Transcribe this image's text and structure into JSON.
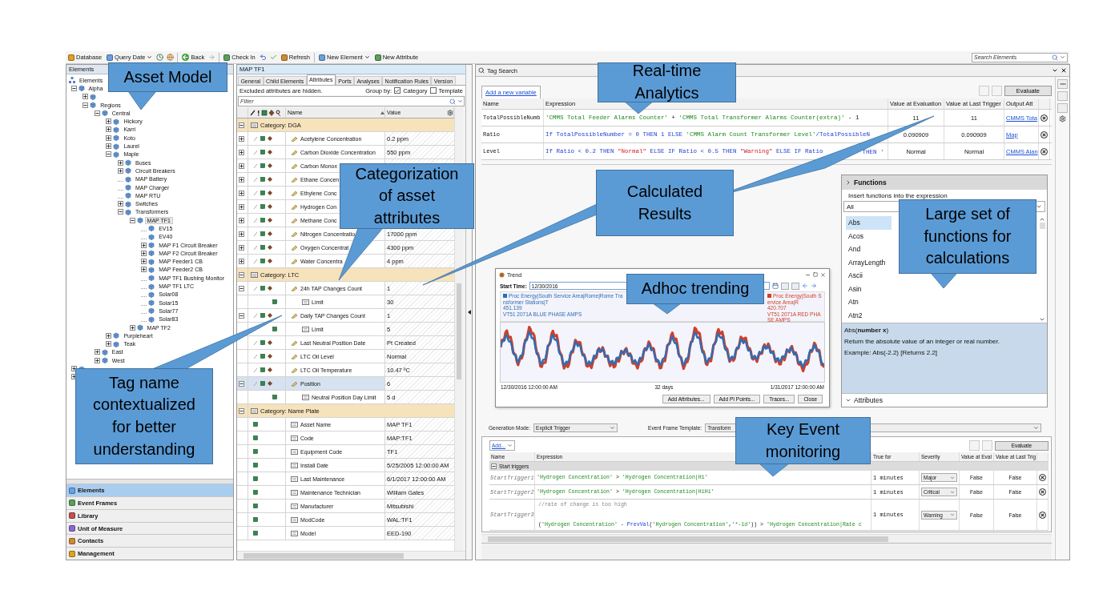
{
  "toolbar": {
    "items": [
      {
        "kind": "button",
        "label": "Database"
      },
      {
        "kind": "menu",
        "label": "Query Date"
      },
      {
        "kind": "clock"
      },
      {
        "kind": "globe"
      },
      {
        "kind": "separator"
      },
      {
        "kind": "back",
        "label": "Back"
      },
      {
        "kind": "forward"
      },
      {
        "kind": "separator"
      },
      {
        "kind": "button",
        "label": "Check In"
      },
      {
        "kind": "undo"
      },
      {
        "kind": "check"
      },
      {
        "kind": "button",
        "label": "Refresh"
      },
      {
        "kind": "separator"
      },
      {
        "kind": "menu",
        "label": "New Element"
      },
      {
        "kind": "button",
        "label": "New Attribute"
      }
    ],
    "search": {
      "placeholder": "Search Elements"
    }
  },
  "elements_panel": {
    "title": "Elements",
    "tree": [
      {
        "label": "Elements",
        "selected": false,
        "children": [
          {
            "label": "Alpha",
            "selected": false,
            "expanded": true,
            "children": [
              {
                "expanded": false
              },
              {
                "label": "Regions",
                "selected": false,
                "expanded": true,
                "children": [
                  {
                    "label": "Central",
                    "selected": false,
                    "expanded": true,
                    "children": [
                      {
                        "label": "Hickory",
                        "selected": false,
                        "expanded": false
                      },
                      {
                        "label": "Karri",
                        "selected": false,
                        "expanded": false
                      },
                      {
                        "label": "Koto",
                        "selected": false,
                        "expanded": false
                      },
                      {
                        "label": "Laurel",
                        "selected": false,
                        "expanded": false
                      },
                      {
                        "label": "Maple",
                        "selected": false,
                        "expanded": true,
                        "children": [
                          {
                            "label": "Buses",
                            "selected": false,
                            "expanded": false
                          },
                          {
                            "label": "Circuit Breakers",
                            "selected": false,
                            "expanded": false
                          },
                          {
                            "label": "MAP Battery",
                            "selected": false
                          },
                          {
                            "label": "MAP Charger",
                            "selected": false
                          },
                          {
                            "label": "MAP RTU",
                            "selected": false
                          },
                          {
                            "label": "Switches",
                            "selected": false,
                            "expanded": false
                          },
                          {
                            "label": "Transformers",
                            "selected": false,
                            "expanded": true,
                            "children": [
                              {
                                "label": "MAP TF1",
                                "selected": true,
                                "expanded": true,
                                "children": [
                                  {
                                    "label": "EV15",
                                    "selected": false
                                  },
                                  {
                                    "label": "EV40",
                                    "selected": false
                                  },
                                  {
                                    "label": "MAP F1 Circuit Breaker",
                                    "selected": false,
                                    "expanded": false
                                  },
                                  {
                                    "label": "MAP F2 Circuit Breaker",
                                    "selected": false,
                                    "expanded": false
                                  },
                                  {
                                    "label": "MAP Feeder1 CB",
                                    "selected": false,
                                    "expanded": false
                                  },
                                  {
                                    "label": "MAP Feeder2 CB",
                                    "selected": false,
                                    "expanded": false
                                  },
                                  {
                                    "label": "MAP TF1 Bushing Monitor",
                                    "selected": false
                                  },
                                  {
                                    "label": "MAP TF1 LTC",
                                    "selected": false
                                  },
                                  {
                                    "label": "Solar08",
                                    "selected": false
                                  },
                                  {
                                    "label": "Solar15",
                                    "selected": false
                                  },
                                  {
                                    "label": "Solar77",
                                    "selected": false
                                  },
                                  {
                                    "label": "Solar83",
                                    "selected": false
                                  }
                                ]
                              },
                              {
                                "label": "MAP TF2",
                                "selected": false,
                                "expanded": false
                              }
                            ]
                          }
                        ]
                      },
                      {
                        "label": "Purpleheart",
                        "selected": false,
                        "expanded": false
                      },
                      {
                        "label": "Teak",
                        "selected": false,
                        "expanded": false
                      }
                    ]
                  },
                  {
                    "label": "East",
                    "selected": false,
                    "expanded": false
                  },
                  {
                    "label": "West",
                    "selected": false,
                    "expanded": false
                  }
                ]
              }
            ]
          },
          {
            "expanded": false
          },
          {
            "expanded": false
          }
        ]
      }
    ],
    "nav": [
      {
        "label": "Elements",
        "selected": true
      },
      {
        "label": "Event Frames",
        "selected": false
      },
      {
        "label": "Library",
        "selected": false
      },
      {
        "label": "Unit of Measure",
        "selected": false
      },
      {
        "label": "Contacts",
        "selected": false
      },
      {
        "label": "Management",
        "selected": false
      }
    ]
  },
  "attributes_panel": {
    "title": "MAP TF1",
    "tabs": [
      {
        "label": "General",
        "selected": false
      },
      {
        "label": "Child Elements",
        "selected": false
      },
      {
        "label": "Attributes",
        "selected": true
      },
      {
        "label": "Ports",
        "selected": false
      },
      {
        "label": "Analyses",
        "selected": false
      },
      {
        "label": "Notification Rules",
        "selected": false
      },
      {
        "label": "Version",
        "selected": false
      }
    ],
    "info": "Excluded attributes are hidden.",
    "group_by": {
      "label": "Group by:",
      "options": [
        {
          "label": "Category",
          "checked": true
        },
        {
          "label": "Template",
          "checked": false
        }
      ]
    },
    "filter": {
      "placeholder": "Filter"
    },
    "columns": [
      "Name",
      "Value"
    ],
    "rows": [
      {
        "kind": "category",
        "label": "Category: DGA",
        "expanded": true,
        "children": [
          {
            "kind": "pi",
            "name": "Acetylene Concentration",
            "value": "0.2 ppm",
            "expanded": false,
            "selected": false
          },
          {
            "kind": "pi",
            "name": "Carbon Dioxide Concentration",
            "value": "550 ppm",
            "expanded": false,
            "selected": false
          },
          {
            "kind": "pi",
            "name": "Carbon Monox",
            "expanded": false,
            "selected": false
          },
          {
            "kind": "pi",
            "name": "Ethane Concen",
            "expanded": false,
            "selected": false
          },
          {
            "kind": "pi",
            "name": "Ethylene Conc",
            "expanded": false,
            "selected": false
          },
          {
            "kind": "pi",
            "name": "Hydrogen Con",
            "expanded": false,
            "selected": false
          },
          {
            "kind": "pi",
            "name": "Methane Conc",
            "expanded": false,
            "selected": false
          },
          {
            "kind": "pi",
            "name": "Nitrogen Concentratio",
            "value": "17000 ppm",
            "expanded": false,
            "selected": false
          },
          {
            "kind": "pi",
            "name": "Oxygen Concentrat",
            "value": "4300 ppm",
            "expanded": false,
            "selected": false
          },
          {
            "kind": "pi",
            "name": "Water Concentra",
            "value": "4 ppm",
            "expanded": false,
            "selected": false
          }
        ]
      },
      {
        "kind": "category",
        "label": "Category: LTC",
        "expanded": true,
        "children": [
          {
            "kind": "pi",
            "name": "24h TAP Changes Count",
            "value": "1",
            "expanded": true,
            "selected": false,
            "children": [
              {
                "kind": "static",
                "name": "Limit",
                "value": "30",
                "selected": false
              }
            ]
          },
          {
            "kind": "pi",
            "name": "Daily TAP Changes Count",
            "value": "1",
            "expanded": true,
            "selected": false,
            "children": [
              {
                "kind": "static",
                "name": "Limit",
                "value": "5",
                "selected": false
              }
            ]
          },
          {
            "kind": "pi",
            "name": "Last Neutral Position Date",
            "value": "Pt Created",
            "selected": false
          },
          {
            "kind": "pi",
            "name": "LTC Oil Level",
            "value": "Normal",
            "selected": false
          },
          {
            "kind": "pi",
            "name": "LTC Oil Temperature",
            "value": "10.47 ºC",
            "selected": false
          },
          {
            "kind": "pi",
            "name": "Position",
            "value": "6",
            "expanded": true,
            "selected": true,
            "children": [
              {
                "kind": "static",
                "name": "Neutral Position Day Limit",
                "value": "5 d",
                "selected": false
              }
            ]
          }
        ]
      },
      {
        "kind": "category",
        "label": "Category: Name Plate",
        "expanded": true,
        "children": [
          {
            "kind": "static",
            "name": "Asset Name",
            "value": "MAP TF1",
            "selected": false
          },
          {
            "kind": "static",
            "name": "Code",
            "value": "MAP:TF1",
            "selected": false
          },
          {
            "kind": "static",
            "name": "Equipment Code",
            "value": "TF1",
            "selected": false
          },
          {
            "kind": "static",
            "name": "Install Date",
            "value": "5/25/2005 12:00:00 AM",
            "selected": false
          },
          {
            "kind": "static",
            "name": "Last Maintenance",
            "value": "6/1/2017 12:00:00 AM",
            "selected": false
          },
          {
            "kind": "static",
            "name": "Maintenance Technician",
            "value": "William Gates",
            "selected": false
          },
          {
            "kind": "static",
            "name": "Manufacturer",
            "value": "Mitsubishi",
            "selected": false
          },
          {
            "kind": "static",
            "name": "ModCode",
            "value": "WAL:TF1",
            "selected": false
          },
          {
            "kind": "static",
            "name": "Model",
            "value": "EED-190",
            "selected": false
          }
        ]
      }
    ]
  },
  "tag_search": {
    "title": "Tag Search",
    "add_variable": "Add a new variable",
    "evaluate": "Evaluate",
    "columns": [
      "Name",
      "Expression",
      "Value at Evaluation",
      "Value at Last Trigger",
      "Output Att"
    ],
    "rows": [
      {
        "name": "TotalPossibleNumb",
        "expression": [
          {
            "kind": "attr",
            "text": "'CMMS Total Feeder Alarms Counter'"
          },
          {
            "kind": "plain",
            "text": " + "
          },
          {
            "kind": "attr",
            "text": "'CMMS Total Transformer Alarms Counter(extra)'"
          },
          {
            "kind": "plain",
            "text": " - 1"
          }
        ],
        "value_eval": "11",
        "value_trigger": "11",
        "output": "CMMS Tota"
      },
      {
        "name": "Ratio",
        "expression": [
          {
            "kind": "code",
            "text": "If TotalPossibleNumber = 0 THEN 1 ELSE "
          },
          {
            "kind": "attr",
            "text": "'CMMS Alarm Count Transformer Level'"
          },
          {
            "kind": "code",
            "text": "/TotalPossibleN"
          }
        ],
        "value_eval": "0.090909",
        "value_trigger": "0.090909",
        "output": "Map"
      },
      {
        "name": "Level",
        "expression": [
          {
            "kind": "code",
            "text": "If Ratio < 0.2 THEN "
          },
          {
            "kind": "string",
            "text": "\"Normal\""
          },
          {
            "kind": "code",
            "text": " ELSE IF Ratio < 0.5 THEN "
          },
          {
            "kind": "string",
            "text": "\"Warning\""
          },
          {
            "kind": "code",
            "text": " ELSE IF Ratio"
          }
        ],
        "expression_tail": [
          {
            "kind": "code",
            "text": "THEN "
          },
          {
            "kind": "string",
            "text": "'"
          }
        ],
        "value_eval": "Normal",
        "value_trigger": "Normal",
        "output": "CMMS Alan"
      }
    ]
  },
  "trend": {
    "title": "Trend",
    "start_label": "Start Time:",
    "start_value": "12/30/2016",
    "legend": [
      {
        "text": "Proc Energy|South Service Area|Rome|Rome Transformer Stations|T",
        "value": "451.139",
        "name": "VT51 2071A BLUE PHASE AMPS",
        "color": "#2e6db4"
      },
      {
        "text": "Proc Energy|South Service Area|R",
        "value": "420.707",
        "name": "VT51 2071A RED PHASE AMPS",
        "color": "#d0402a"
      }
    ],
    "axis": [
      "12/30/2016 12:00:00 AM",
      "32 days",
      "1/31/2017 12:00:00 AM"
    ],
    "buttons": [
      "Add Attributes...",
      "Add PI Points...",
      "Traces...",
      "Close"
    ]
  },
  "functions": {
    "title": "Functions",
    "hint": "Insert functions into the expression",
    "filter": "All",
    "items": [
      {
        "label": "Abs",
        "selected": true
      },
      {
        "label": "Acos",
        "selected": false
      },
      {
        "label": "And",
        "selected": false
      },
      {
        "label": "ArrayLength",
        "selected": false
      },
      {
        "label": "Ascii",
        "selected": false
      },
      {
        "label": "Asin",
        "selected": false
      },
      {
        "label": "Atn",
        "selected": false
      },
      {
        "label": "Atn2",
        "selected": false
      }
    ],
    "signature": "Abs(**number x**)",
    "description": "Return the absolute value of an integer or real number.",
    "example": "Example: Abs(-2.2) [Returns 2.2]",
    "footer": "Attributes"
  },
  "event_triggers": {
    "generation_label": "Generation Mode:",
    "generation_value": "Explicit Trigger",
    "template_label": "Event Frame Template:",
    "template_value": "Transform",
    "add": "Add...",
    "evaluate": "Evaluate",
    "columns": [
      "Name",
      "Expression",
      "True for",
      "Severity",
      "Value at Eval",
      "Value at Last Trig"
    ],
    "group": {
      "label": "Start triggers",
      "expanded": true
    },
    "rows": [
      {
        "name": "StartTrigger1",
        "expression": [
          {
            "kind": "attr",
            "text": "'Hydrogen Concentration'"
          },
          {
            "kind": "plain",
            "text": " > "
          },
          {
            "kind": "attr",
            "text": "'Hydrogen Concentration|Hi'"
          }
        ],
        "true_for": "1 minutes",
        "severity": "Major",
        "value_eval": "False",
        "value_trigger": "False"
      },
      {
        "name": "StartTrigger2",
        "expression": [
          {
            "kind": "attr",
            "text": "'Hydrogen Concentration'"
          },
          {
            "kind": "plain",
            "text": " > "
          },
          {
            "kind": "attr",
            "text": "'Hydrogen Concentration|HiHi'"
          }
        ],
        "true_for": "1 minutes",
        "severity": "Critical",
        "value_eval": "False",
        "value_trigger": "False"
      },
      {
        "name": "StartTrigger3",
        "comment": "//rate of change is too high",
        "expression": [
          {
            "kind": "plain",
            "text": "("
          },
          {
            "kind": "attr",
            "text": "'Hydrogen Concentration'"
          },
          {
            "kind": "plain",
            "text": " - "
          },
          {
            "kind": "code",
            "text": "PrevVal"
          },
          {
            "kind": "plain",
            "text": "("
          },
          {
            "kind": "attr",
            "text": "'Hydrogen Concentration'"
          },
          {
            "kind": "plain",
            "text": ","
          },
          {
            "kind": "attr",
            "text": "'*-1d'"
          },
          {
            "kind": "plain",
            "text": ")) > "
          },
          {
            "kind": "attr",
            "text": "'Hydrogen Concentration|Rate c"
          }
        ],
        "true_for": "1 minutes",
        "severity": "Warning",
        "value_eval": "False",
        "value_trigger": "False"
      }
    ]
  },
  "callouts": [
    {
      "text": "Asset Model"
    },
    {
      "text": "Real-time Analytics"
    },
    {
      "text": "Categorization of asset attributes"
    },
    {
      "text": "Calculated Results"
    },
    {
      "text": "Large set of functions for calculations"
    },
    {
      "text": "Adhoc trending"
    },
    {
      "text": "Tag name contextualized for better understanding"
    },
    {
      "text": "Key Event monitoring"
    }
  ]
}
